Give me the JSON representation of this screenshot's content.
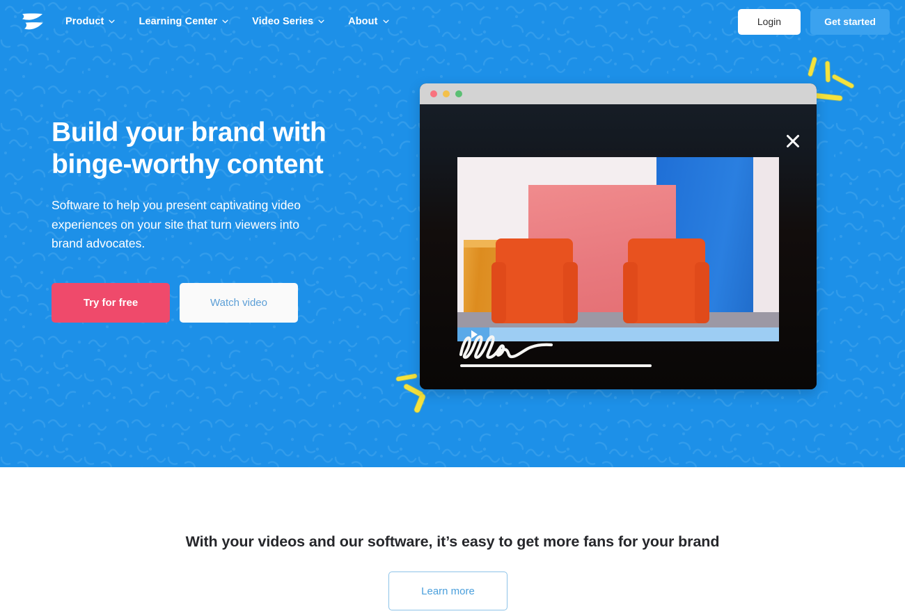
{
  "theme": {
    "hero_blue": "#1d90e8",
    "pattern_blue": "#44a6ee",
    "accent_pink": "#ef4a6b",
    "accent_light_blue": "#3ba2ef",
    "sparkle_yellow": "#f5e23c",
    "text_dark": "#26272b",
    "link_blue": "#4a9fdc"
  },
  "nav": {
    "logo_name": "wistia-logo",
    "links": [
      {
        "label": "Product",
        "icon": "chevron-down-icon"
      },
      {
        "label": "Learning Center",
        "icon": "chevron-down-icon"
      },
      {
        "label": "Video Series",
        "icon": "chevron-down-icon"
      },
      {
        "label": "About",
        "icon": "chevron-down-icon"
      }
    ],
    "login_label": "Login",
    "get_started_label": "Get started"
  },
  "hero": {
    "title_line1": "Build your brand with",
    "title_line2": "binge-worthy content",
    "subtitle": "Software to help you present captivating video experiences on your site that turn viewers into brand advocates.",
    "primary_cta": "Try for free",
    "secondary_cta": "Watch video"
  },
  "video_window": {
    "traffic_lights": [
      "red",
      "yellow",
      "green"
    ],
    "close_icon": "close-x-icon",
    "play_icon": "play-icon",
    "signature_text": "ellen",
    "progress_percent": 10
  },
  "decorations": {
    "sparkle_top_right": "sparkle-burst-icon",
    "sparkle_bottom_left": "sparkle-burst-icon"
  },
  "bottom": {
    "title": "With your videos and our software, it’s easy to get more fans for your brand",
    "cta_label": "Learn more"
  }
}
